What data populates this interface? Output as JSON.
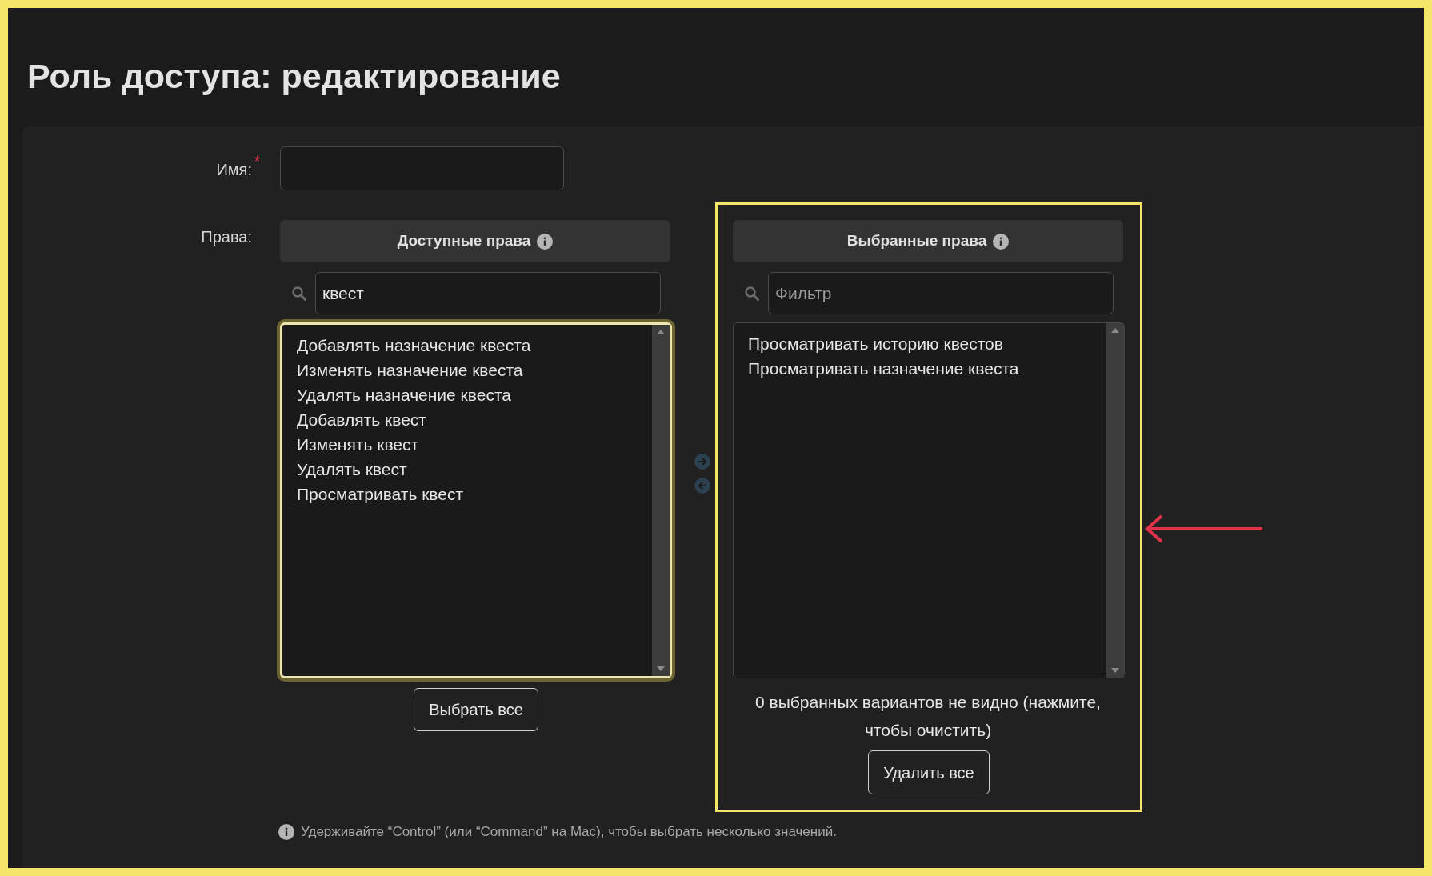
{
  "title": "Роль доступа: редактирование",
  "name_field": {
    "label": "Имя:",
    "required_mark": "*"
  },
  "rights_label": "Права:",
  "available": {
    "header": "Доступные права",
    "search_value": "квест",
    "focused": true,
    "highlighted": false,
    "items": [
      "Добавлять назначение квеста",
      "Изменять назначение квеста",
      "Удалять назначение квеста",
      "Добавлять квест",
      "Изменять квест",
      "Удалять квест",
      "Просматривать квест"
    ],
    "button": "Выбрать все"
  },
  "chosen": {
    "header": "Выбранные права",
    "search_placeholder": "Фильтр",
    "focused": false,
    "highlighted": true,
    "items": [
      "Просматривать историю квестов",
      "Просматривать назначение квеста"
    ],
    "note": "0 выбранных вариантов не видно (нажмите, чтобы очистить)",
    "button": "Удалить все"
  },
  "hint": "Удерживайте “Control” (или “Command” на Mac), чтобы выбрать несколько значений."
}
